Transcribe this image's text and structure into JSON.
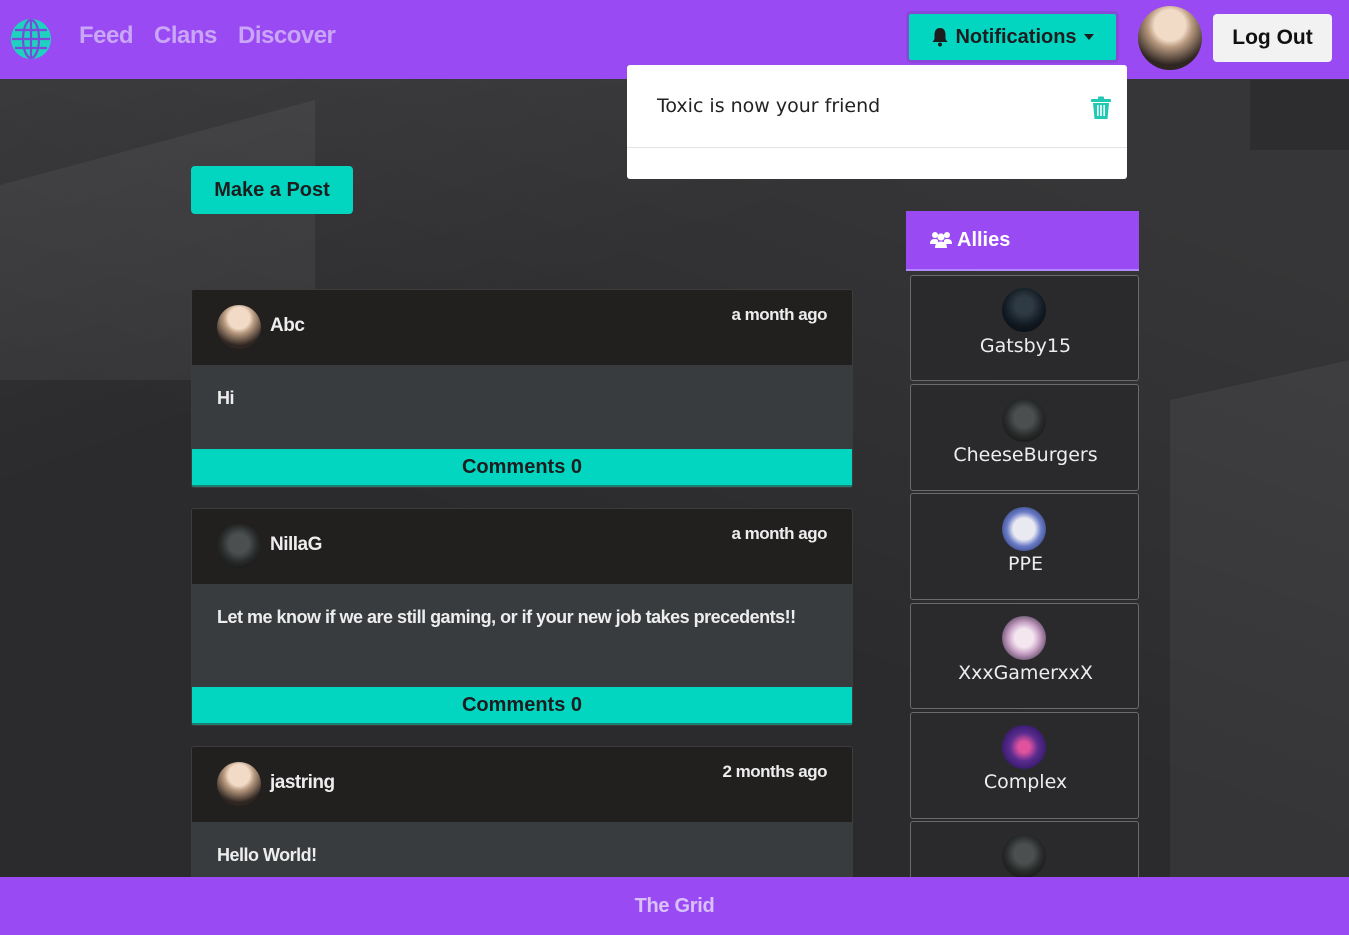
{
  "nav": {
    "links": [
      "Feed",
      "Clans",
      "Discover"
    ],
    "notifications_label": "Notifications",
    "logout_label": "Log Out"
  },
  "notifications": {
    "items": [
      {
        "text": "Toxic is now your friend"
      }
    ]
  },
  "feed": {
    "make_post_label": "Make a Post",
    "posts": [
      {
        "author": "Abc",
        "time": "a month ago",
        "body": "Hi",
        "comments_label": "Comments 0"
      },
      {
        "author": "NillaG",
        "time": "a month ago",
        "body": "Let me know if we are still gaming, or if your new job takes precedents!!",
        "comments_label": "Comments 0"
      },
      {
        "author": "jastring",
        "time": "2 months ago",
        "body": "Hello World!",
        "comments_label": ""
      }
    ]
  },
  "allies": {
    "title": "Allies",
    "items": [
      {
        "name": "Gatsby15"
      },
      {
        "name": "CheeseBurgers"
      },
      {
        "name": "PPE"
      },
      {
        "name": "XxxGamerxxX"
      },
      {
        "name": "Complex"
      }
    ]
  },
  "footer": {
    "text": "The Grid"
  },
  "colors": {
    "brand_purple": "#9a4af2",
    "accent_teal": "#03d6c0",
    "post_header": "#221f1f",
    "post_body": "#393c3e"
  }
}
